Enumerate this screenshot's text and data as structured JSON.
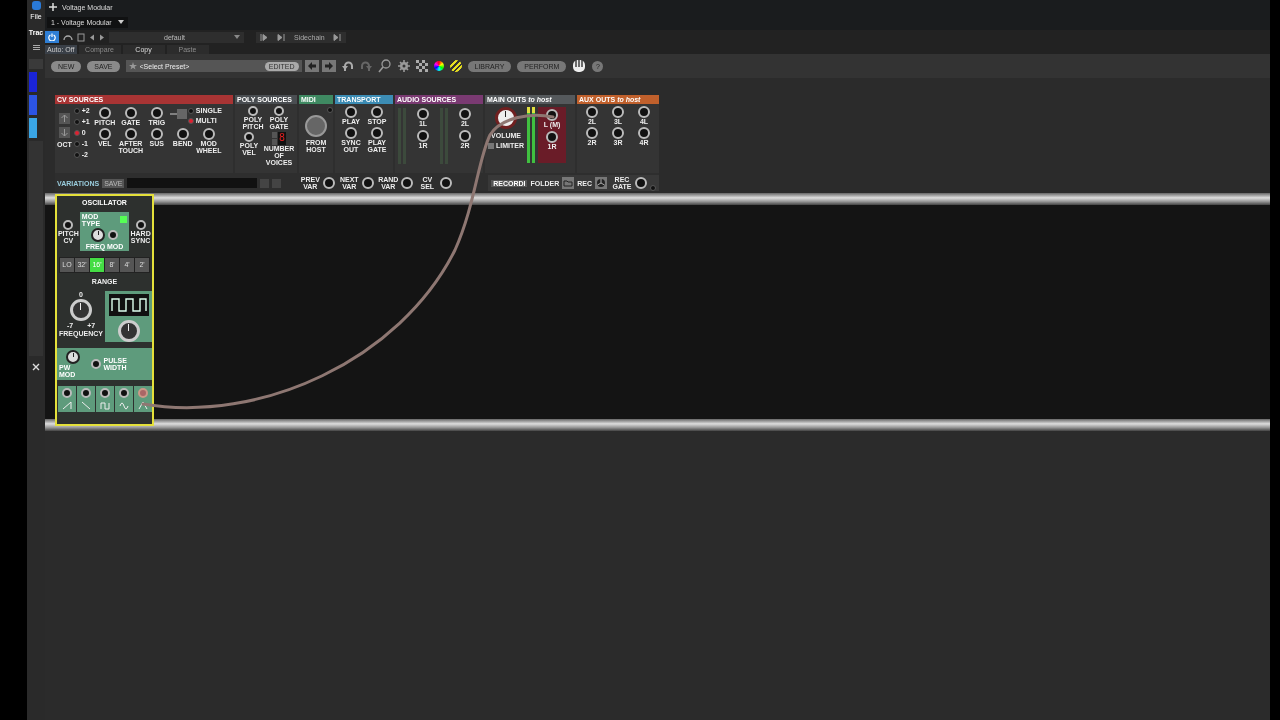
{
  "host": {
    "menu": "File",
    "track_label": "Trac",
    "tab_title": "Voltage Modular",
    "instance": "1 - Voltage Modular",
    "preset": "default",
    "sidechain": "Sidechain",
    "power_on": true,
    "auto": "Auto: Off",
    "compare": "Compare",
    "copy": "Copy",
    "paste": "Paste"
  },
  "toolbar": {
    "new": "NEW",
    "save": "SAVE",
    "preset_placeholder": "<Select Preset>",
    "edited": "EDITED",
    "library": "LIBRARY",
    "perform": "PERFORM",
    "help": "?"
  },
  "sections": [
    {
      "kind": "cv",
      "title": "CV SOURCES",
      "color": "#a83434",
      "octaves": [
        {
          "label": "+2",
          "selected": false
        },
        {
          "label": "+1",
          "selected": false
        },
        {
          "label": "0",
          "selected": true
        },
        {
          "label": "-1",
          "selected": false
        },
        {
          "label": "-2",
          "selected": false
        }
      ],
      "octave_label": "OCT",
      "row_1": [
        "PITCH",
        "GATE",
        "TRIG"
      ],
      "trigger_modes": [
        {
          "label": "SINGLE",
          "selected": false
        },
        {
          "label": "MULTI",
          "selected": true
        }
      ],
      "row_2": [
        "VEL",
        "AFTER TOUCH",
        "SUS",
        "BEND",
        "MOD WHEEL"
      ]
    },
    {
      "kind": "poly",
      "title": "POLY SOURCES",
      "color": "#4a4e52",
      "row_1": [
        "POLY PITCH",
        "POLY GATE"
      ],
      "row_2": [
        "POLY VEL"
      ],
      "voices_digit": "8",
      "voices_label": "NUMBER OF VOICES"
    },
    {
      "kind": "midi",
      "title": "MIDI",
      "color": "#3f8a62",
      "port_label": "FROM HOST"
    },
    {
      "kind": "transport",
      "title": "TRANSPORT",
      "color": "#3c8cb4",
      "row_1": [
        "PLAY",
        "STOP"
      ],
      "row_2": [
        "SYNC OUT",
        "PLAY GATE"
      ]
    },
    {
      "kind": "audio",
      "title": "AUDIO SOURCES",
      "color": "#7a3a72",
      "row_1": [
        "1L",
        "2L"
      ],
      "row_2": [
        "1R",
        "2R"
      ]
    },
    {
      "kind": "main",
      "title": "MAIN OUTS *to host*",
      "color": "#55595c",
      "volume_label": "VOLUME",
      "limiter_label": "LIMITER",
      "limiter_on": false,
      "row_1": [
        "L (M)"
      ],
      "row_2": [
        "1R"
      ]
    },
    {
      "kind": "aux",
      "title": "AUX OUTS *to host*",
      "color": "#c0602c",
      "row_1": [
        "2L",
        "3L",
        "4L"
      ],
      "row_2": [
        "2R",
        "3R",
        "4R"
      ]
    }
  ],
  "variations": {
    "title": "VARIATIONS",
    "save": "SAVE",
    "jacks": [
      "PREV VAR",
      "NEXT VAR",
      "RAND VAR",
      "CV SEL"
    ]
  },
  "recording": {
    "title": "RECORDI",
    "folder": "FOLDER",
    "rec": "REC",
    "rec_gate": "REC GATE"
  },
  "oscillator": {
    "title": "OSCILLATOR",
    "pitch_cv": "PITCH CV",
    "mod_type": "MOD TYPE",
    "mod_type_on": true,
    "freq_mod": "FREQ MOD",
    "hard_sync": "HARD SYNC",
    "ranges": [
      {
        "label": "LO",
        "selected": false
      },
      {
        "label": "32'",
        "selected": false
      },
      {
        "label": "16'",
        "selected": true
      },
      {
        "label": "8'",
        "selected": false
      },
      {
        "label": "4'",
        "selected": false
      },
      {
        "label": "2'",
        "selected": false
      }
    ],
    "range_label": "RANGE",
    "freq_zero": "0",
    "freq_min": "-7",
    "freq_max": "+7",
    "frequency": "FREQUENCY",
    "pw_mod": "PW MOD",
    "pulse_width": "PULSE WIDTH",
    "outputs": [
      {
        "kind": "saw",
        "connected": false
      },
      {
        "kind": "ramp",
        "connected": false
      },
      {
        "kind": "square",
        "connected": false
      },
      {
        "kind": "sine",
        "connected": false
      },
      {
        "kind": "triangle",
        "connected": true
      }
    ]
  }
}
